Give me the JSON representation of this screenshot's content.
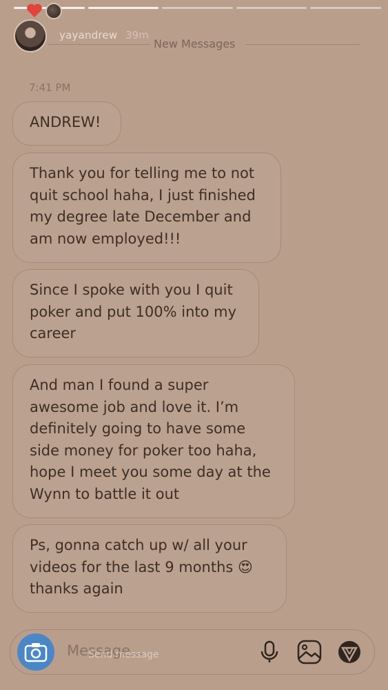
{
  "story": {
    "username": "yayandrew",
    "time": "39m"
  },
  "divider": {
    "label": "New Messages"
  },
  "chat": {
    "timestamp": "7:41 PM",
    "messages": [
      {
        "text": "ANDREW!"
      },
      {
        "text": "Thank you for telling me to not quit school haha, I just finished my degree late December and am now employed!!!"
      },
      {
        "text": "Since I spoke with you I quit poker and put 100% into my career"
      },
      {
        "text": "And man I found a super awesome job and love it. I’m definitely going to have some side money for poker too haha, hope I meet you some day at the Wynn to battle it out"
      },
      {
        "text": "Ps, gonna catch up w/ all your videos for the last 9 months 😍 thanks again"
      }
    ]
  },
  "composer": {
    "placeholder": "Message...",
    "overlay_hint": "Send message"
  },
  "icons": {
    "heart": "heart-icon",
    "camera": "camera-icon",
    "mic": "microphone-icon",
    "gallery": "gallery-icon",
    "sticker": "sticker-icon"
  },
  "colors": {
    "background": "#b99e8b",
    "camera_button": "#4a87c8",
    "heart": "#e2433b"
  }
}
